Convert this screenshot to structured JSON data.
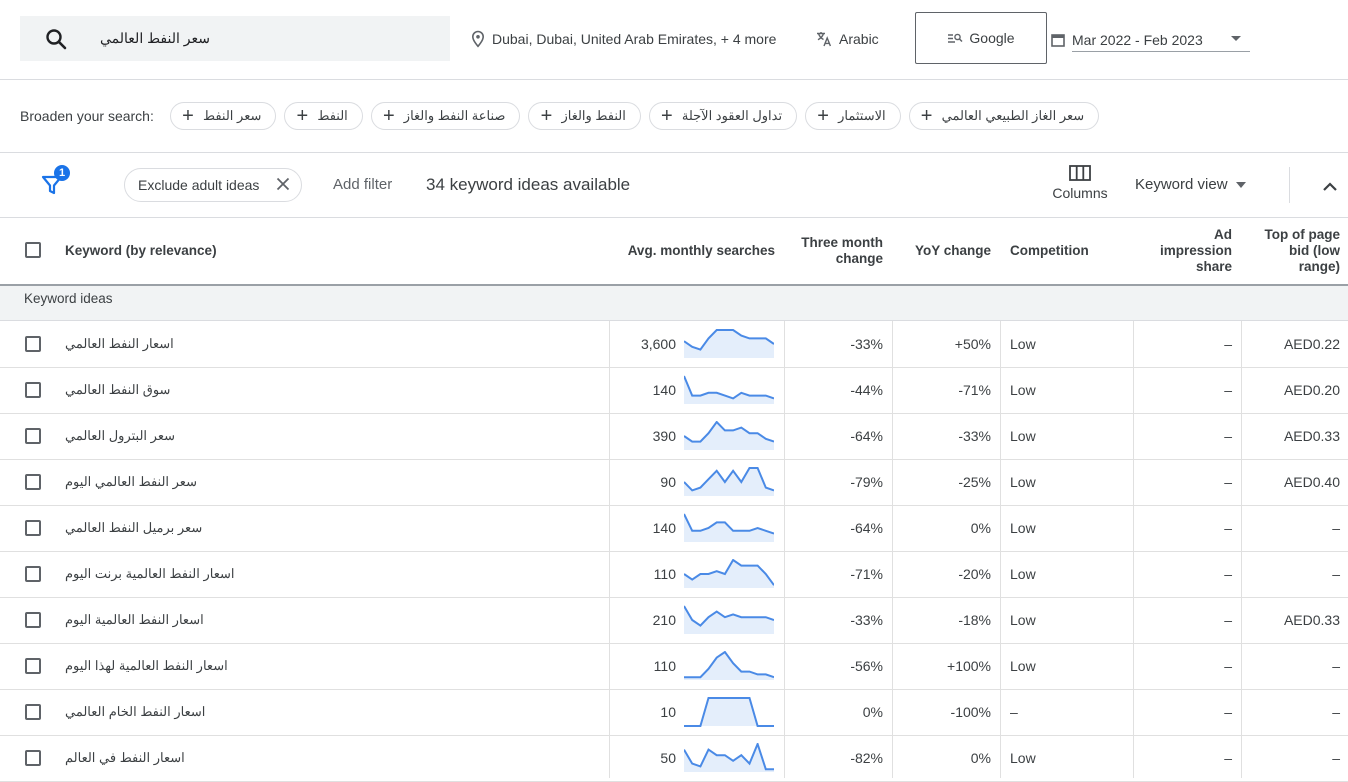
{
  "search": {
    "query": "سعر النفط العالمي"
  },
  "location": "Dubai, Dubai, United Arab Emirates, + 4 more",
  "language": "Arabic",
  "network": "Google",
  "date_range": "Mar 2022 - Feb 2023",
  "broaden": {
    "label": "Broaden your search:",
    "chips": [
      "سعر النفط",
      "النفط",
      "صناعة النفط والغاز",
      "النفط والغاز",
      "تداول العقود الآجلة",
      "الاستثمار",
      "سعر الغاز الطبيعي العالمي"
    ]
  },
  "filters": {
    "badge": "1",
    "exclude_chip": "Exclude adult ideas",
    "add_filter": "Add filter",
    "ideas_count": "34 keyword ideas available",
    "columns_label": "Columns",
    "view_label": "Keyword view"
  },
  "table": {
    "headers": {
      "keyword": "Keyword (by relevance)",
      "avg": "Avg. monthly searches",
      "tmc": "Three month change",
      "yoy": "YoY change",
      "competition": "Competition",
      "impression": "Ad impression share",
      "bid": "Top of page bid (low range)"
    },
    "group_label": "Keyword ideas",
    "accent_color": "#4a8ae6",
    "rows": [
      {
        "keyword": "اسعار النفط العالمي",
        "avg": "3,600",
        "tmc": "-33%",
        "yoy": "+50%",
        "competition": "Low",
        "impression": "–",
        "bid": "AED0.22",
        "trend": [
          6,
          4,
          3,
          7,
          10,
          10,
          10,
          8,
          7,
          7,
          7,
          5
        ]
      },
      {
        "keyword": "سوق النفط العالمي",
        "avg": "140",
        "tmc": "-44%",
        "yoy": "-71%",
        "competition": "Low",
        "impression": "–",
        "bid": "AED0.20",
        "trend": [
          10,
          3,
          3,
          4,
          4,
          3,
          2,
          4,
          3,
          3,
          3,
          2
        ]
      },
      {
        "keyword": "سعر البترول العالمي",
        "avg": "390",
        "tmc": "-64%",
        "yoy": "-33%",
        "competition": "Low",
        "impression": "–",
        "bid": "AED0.33",
        "trend": [
          5,
          3,
          3,
          6,
          10,
          7,
          7,
          8,
          6,
          6,
          4,
          3
        ]
      },
      {
        "keyword": "سعر النفط العالمي اليوم",
        "avg": "90",
        "tmc": "-79%",
        "yoy": "-25%",
        "competition": "Low",
        "impression": "–",
        "bid": "AED0.40",
        "trend": [
          5,
          2,
          3,
          6,
          9,
          5,
          9,
          5,
          10,
          10,
          3,
          2
        ]
      },
      {
        "keyword": "سعر برميل النفط العالمي",
        "avg": "140",
        "tmc": "-64%",
        "yoy": "0%",
        "competition": "Low",
        "impression": "–",
        "bid": "–",
        "trend": [
          10,
          4,
          4,
          5,
          7,
          7,
          4,
          4,
          4,
          5,
          4,
          3
        ]
      },
      {
        "keyword": "اسعار النفط العالمية برنت اليوم",
        "avg": "110",
        "tmc": "-71%",
        "yoy": "-20%",
        "competition": "Low",
        "impression": "–",
        "bid": "–",
        "trend": [
          5,
          3,
          5,
          5,
          6,
          5,
          10,
          8,
          8,
          8,
          5,
          1
        ]
      },
      {
        "keyword": "اسعار النفط العالمية اليوم",
        "avg": "210",
        "tmc": "-33%",
        "yoy": "-18%",
        "competition": "Low",
        "impression": "–",
        "bid": "AED0.33",
        "trend": [
          10,
          5,
          3,
          6,
          8,
          6,
          7,
          6,
          6,
          6,
          6,
          5
        ]
      },
      {
        "keyword": "اسعار النفط العالمية لهذا اليوم",
        "avg": "110",
        "tmc": "-56%",
        "yoy": "+100%",
        "competition": "Low",
        "impression": "–",
        "bid": "–",
        "trend": [
          1,
          1,
          1,
          4,
          8,
          10,
          6,
          3,
          3,
          2,
          2,
          1
        ]
      },
      {
        "keyword": "اسعار النفط الخام العالمي",
        "avg": "10",
        "tmc": "0%",
        "yoy": "-100%",
        "competition": "–",
        "impression": "–",
        "bid": "–",
        "trend": [
          0,
          0,
          0,
          10,
          10,
          10,
          10,
          10,
          10,
          0,
          0,
          0
        ]
      },
      {
        "keyword": "اسعار النفط في العالم",
        "avg": "50",
        "tmc": "-82%",
        "yoy": "0%",
        "competition": "Low",
        "impression": "–",
        "bid": "–",
        "trend": [
          8,
          3,
          2,
          8,
          6,
          6,
          4,
          6,
          3,
          10,
          1,
          1
        ]
      }
    ]
  }
}
